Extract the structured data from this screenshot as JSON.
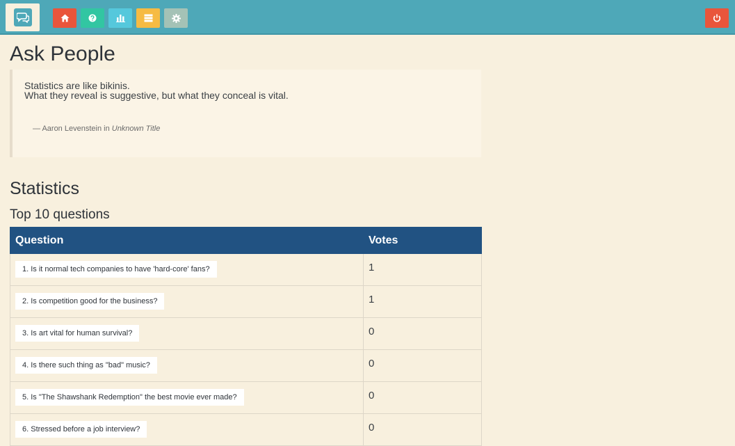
{
  "nav": {
    "buttons": [
      {
        "name": "home-button",
        "icon": "home-icon",
        "color": "#e9553b"
      },
      {
        "name": "questions-button",
        "icon": "question-icon",
        "color": "#32c6a2"
      },
      {
        "name": "statistics-button",
        "icon": "bar-chart-icon",
        "color": "#55c8dc"
      },
      {
        "name": "database-button",
        "icon": "database-icon",
        "color": "#f6bb43"
      },
      {
        "name": "settings-button",
        "icon": "gear-icon",
        "color": "#a4c2b6"
      }
    ],
    "logout": {
      "icon": "power-icon",
      "color": "#e9553b"
    }
  },
  "page": {
    "title": "Ask People"
  },
  "quote": {
    "line1": "Statistics are like bikinis.",
    "line2": "What they reveal is suggestive, but what they conceal is vital.",
    "author_prefix": "— Aaron Levenstein in",
    "source": "Unknown Title"
  },
  "statistics": {
    "heading": "Statistics",
    "subheading": "Top 10 questions",
    "columns": {
      "question": "Question",
      "votes": "Votes"
    },
    "rows": [
      {
        "question": "1. Is it normal tech companies to have 'hard-core' fans?",
        "votes": "1"
      },
      {
        "question": "2. Is competition good for the business?",
        "votes": "1"
      },
      {
        "question": "3. Is art vital for human survival?",
        "votes": "0"
      },
      {
        "question": "4. Is there such thing as \"bad\" music?",
        "votes": "0"
      },
      {
        "question": "5. Is \"The Shawshank Redemption\" the best movie ever made?",
        "votes": "0"
      },
      {
        "question": "6. Stressed before a job interview?",
        "votes": "0"
      }
    ]
  },
  "colors": {
    "topbar": "#4ea8b8",
    "background": "#f8f0de",
    "table_header": "#215282"
  }
}
